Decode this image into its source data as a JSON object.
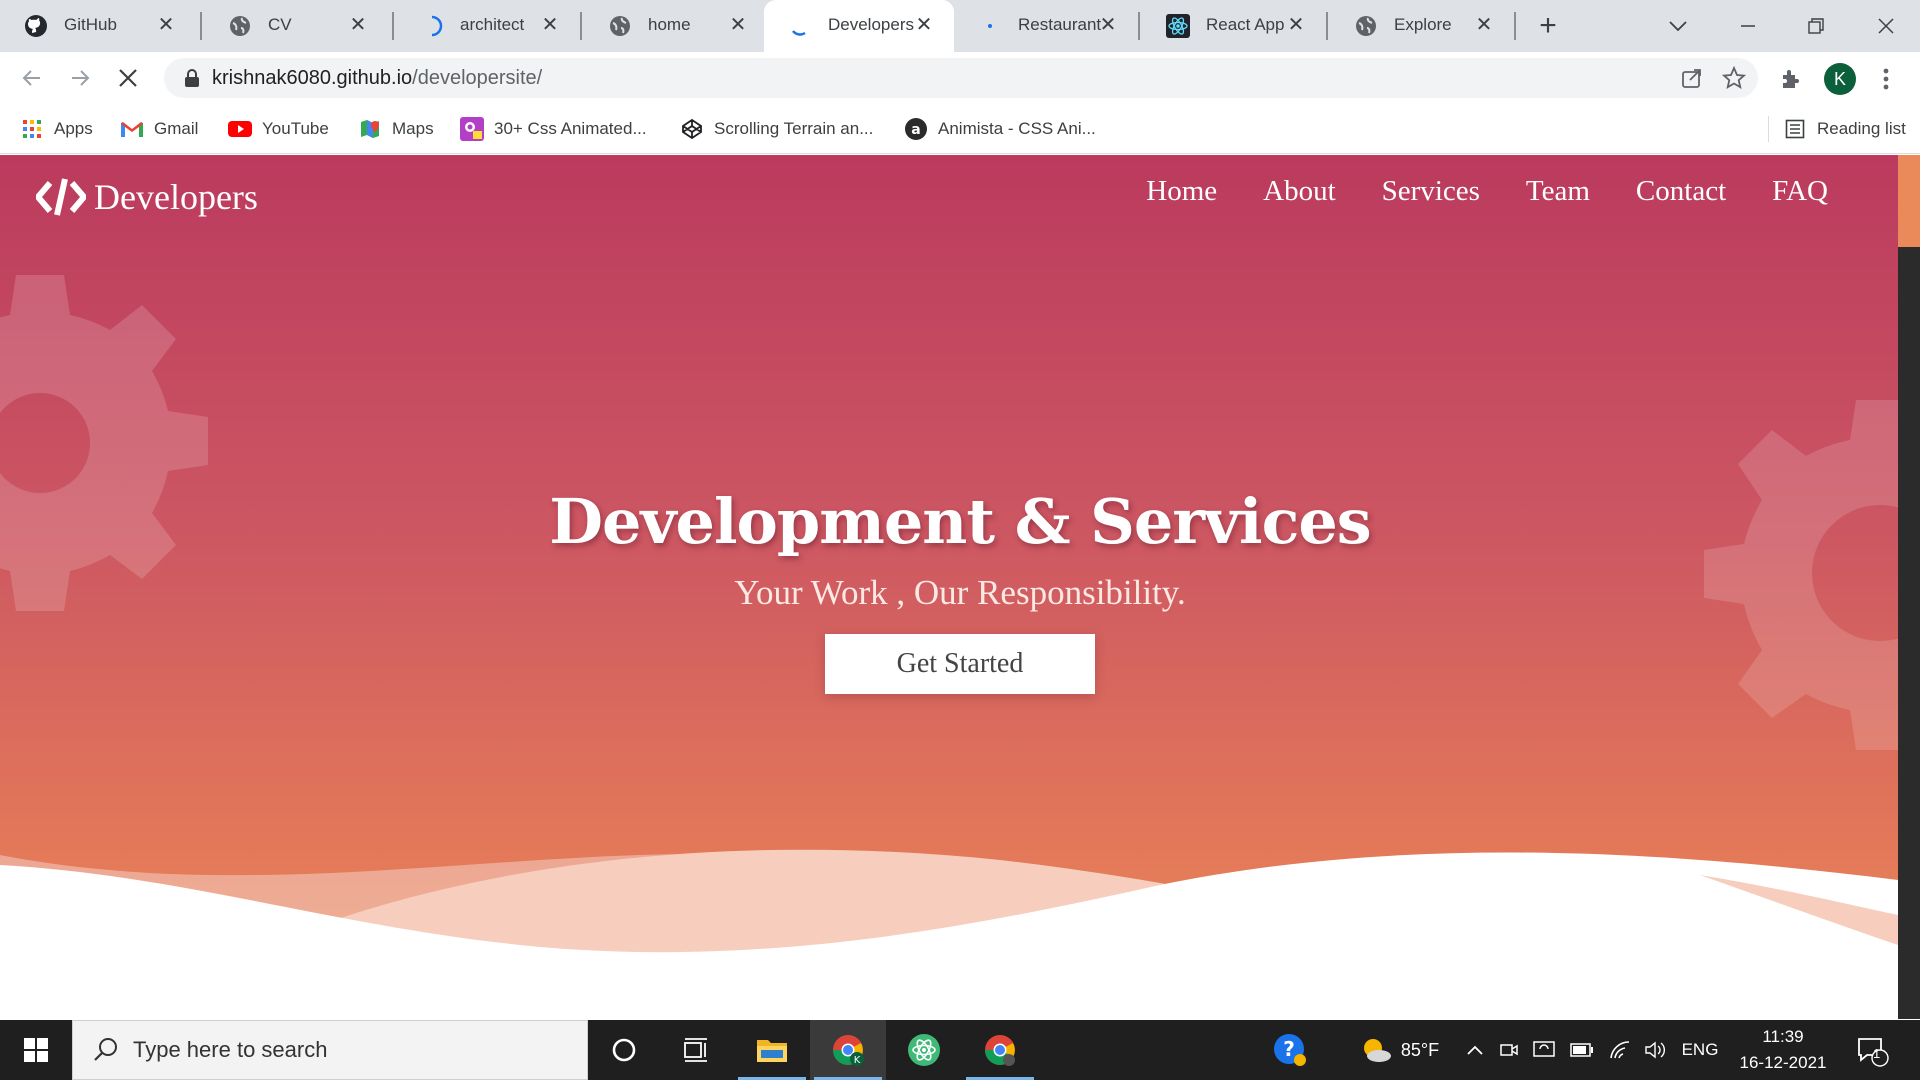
{
  "browser": {
    "tabs": [
      {
        "title": "GitHub",
        "icon": "github-icon"
      },
      {
        "title": "CV",
        "icon": "globe-icon"
      },
      {
        "title": "architect",
        "icon": "loading-spinner-icon"
      },
      {
        "title": "home",
        "icon": "globe-icon"
      },
      {
        "title": "Developers",
        "icon": "loading-spinner-icon",
        "active": true
      },
      {
        "title": "Restaurant",
        "icon": "loading-spinner-icon"
      },
      {
        "title": "React App",
        "icon": "react-icon"
      },
      {
        "title": "Explore",
        "icon": "globe-icon"
      }
    ],
    "address": {
      "host": "krishnak6080.github.io",
      "path": "/developersite/"
    },
    "profile_initial": "K",
    "bookmarks": [
      {
        "label": "Apps",
        "icon": "apps-grid-icon"
      },
      {
        "label": "Gmail",
        "icon": "gmail-icon"
      },
      {
        "label": "YouTube",
        "icon": "youtube-icon"
      },
      {
        "label": "Maps",
        "icon": "maps-icon"
      },
      {
        "label": "30+ Css Animated...",
        "icon": "css-animated-icon"
      },
      {
        "label": "Scrolling Terrain an...",
        "icon": "codepen-icon"
      },
      {
        "label": "Animista - CSS Ani...",
        "icon": "animista-icon"
      }
    ],
    "reading_list": "Reading list"
  },
  "site": {
    "logo_text": "Developers",
    "nav": [
      "Home",
      "About",
      "Services",
      "Team",
      "Contact",
      "FAQ"
    ],
    "hero": {
      "title": "Development & Services",
      "subtitle": "Your Work , Our Responsibility.",
      "cta": "Get Started"
    },
    "colors": {
      "gradient_top": "#bb3a5e",
      "gradient_bottom": "#ea8c5a",
      "scroll_thumb": "#ea8a5a"
    }
  },
  "taskbar": {
    "search_placeholder": "Type here to search",
    "weather": "85°F",
    "language": "ENG",
    "time": "11:39",
    "date": "16-12-2021",
    "notification_count": "1"
  }
}
